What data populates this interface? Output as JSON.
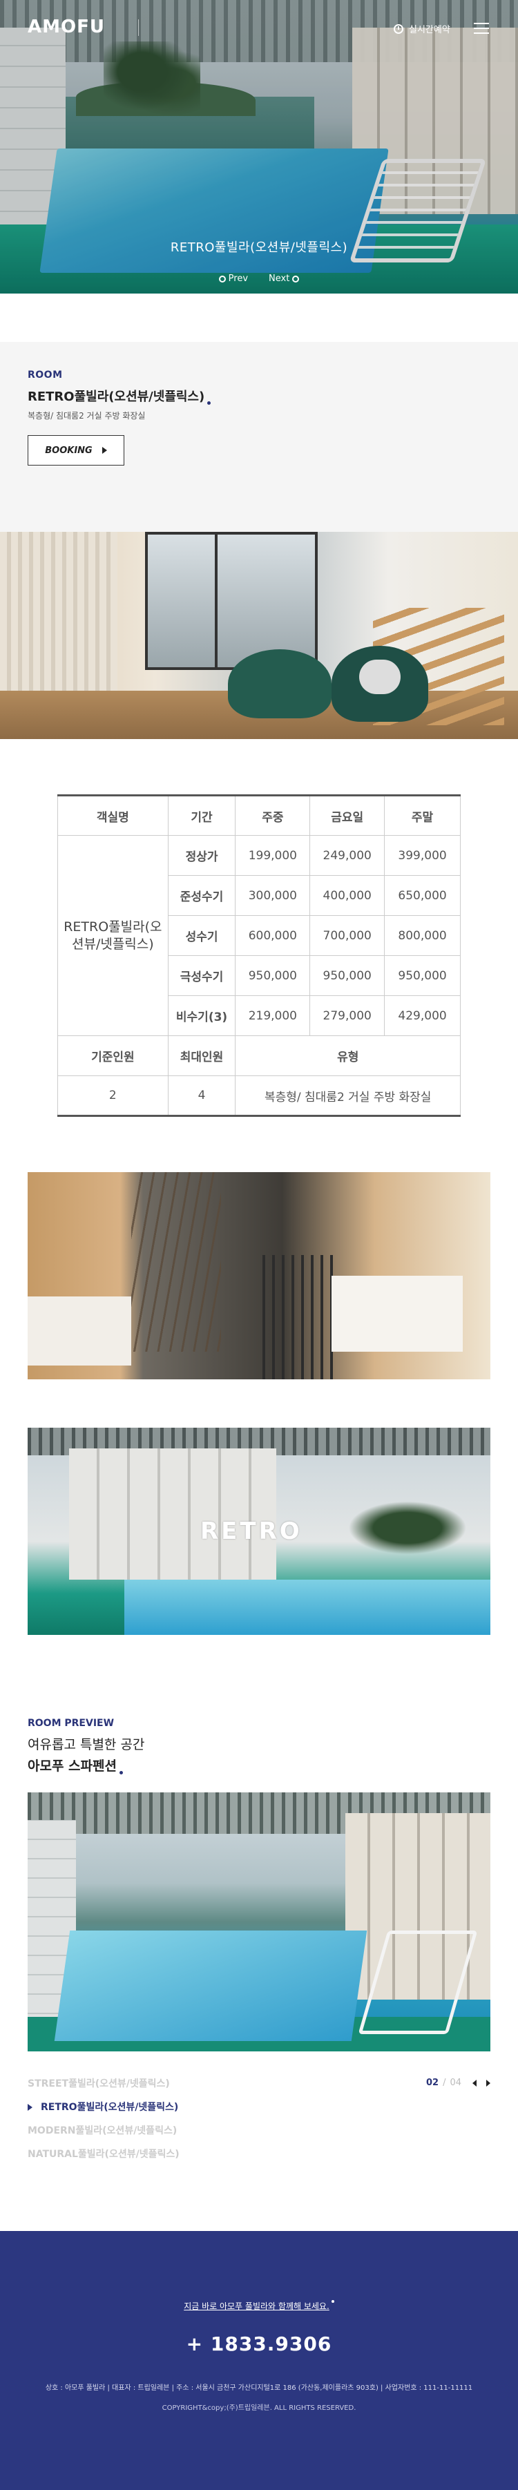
{
  "header": {
    "logo": "AMOFU",
    "reserve_label": "실시간예약"
  },
  "hero": {
    "caption": "RETRO풀빌라(오션뷰/넷플릭스)",
    "prev_label": "Prev",
    "next_label": "Next"
  },
  "room": {
    "section_label": "ROOM",
    "name": "RETRO풀빌라(오션뷰/넷플릭스)",
    "description": "복층형/ 침대룸2 거실 주방 화장실",
    "booking_label": "BOOKING"
  },
  "price_table": {
    "headers": [
      "객실명",
      "기간",
      "주중",
      "금요일",
      "주말"
    ],
    "room_name": "RETRO풀빌라(오션뷰/넷플릭스)",
    "rows": [
      {
        "season": "정상가",
        "weekday": "199,000",
        "friday": "249,000",
        "weekend": "399,000"
      },
      {
        "season": "준성수기",
        "weekday": "300,000",
        "friday": "400,000",
        "weekend": "650,000"
      },
      {
        "season": "성수기",
        "weekday": "600,000",
        "friday": "700,000",
        "weekend": "800,000"
      },
      {
        "season": "극성수기",
        "weekday": "950,000",
        "friday": "950,000",
        "weekend": "950,000"
      },
      {
        "season": "비수기(3)",
        "weekday": "219,000",
        "friday": "279,000",
        "weekend": "429,000"
      }
    ],
    "sub_headers": [
      "기준인원",
      "최대인원",
      "유형"
    ],
    "capacity": {
      "standard": "2",
      "max": "4",
      "type": "복층형/ 침대룸2 거실 주방 화장실"
    }
  },
  "gallery": {
    "retro_sign": "RETRO"
  },
  "preview": {
    "section_label": "ROOM PREVIEW",
    "title_line1": "여유롭고 특별한 공간",
    "title_line2": "아모푸 스파펜션",
    "rooms": [
      "STREET풀빌라(오션뷰/넷플릭스)",
      "RETRO풀빌라(오션뷰/넷플릭스)",
      "MODERN풀빌라(오션뷰/넷플릭스)",
      "NATURAL풀빌라(오션뷰/넷플릭스)"
    ],
    "active_index": 1,
    "pager_current": "02",
    "pager_sep": "/",
    "pager_total": "04"
  },
  "footer": {
    "cta": "지금 바로 아모푸 풀빌라와 함께해 보세요.",
    "phone": "+ 1833.9306",
    "info": "상호 : 아모푸 풀빌라  |  대표자 : 트립일레븐  |  주소 : 서울시 금천구 가산디지털1로 186 (가산동,제이플라츠 903호)  |  사업자번호 : 111-11-11111",
    "copyright": "COPYRIGHT&copy;(주)트립일레븐. ALL RIGHTS RESERVED."
  },
  "colors": {
    "brand_navy": "#2c3780",
    "accent_text": "#2a3479"
  }
}
